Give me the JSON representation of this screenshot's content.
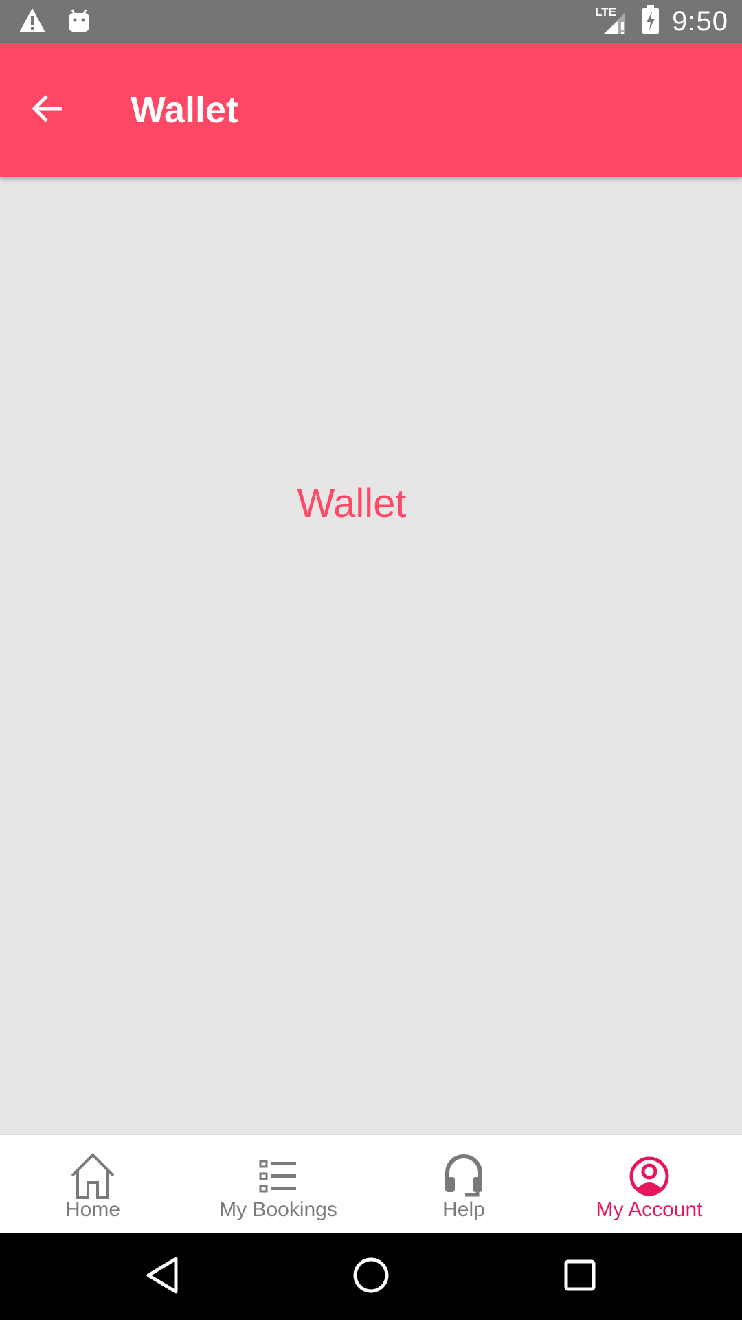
{
  "status_bar": {
    "time": "9:50",
    "network_label": "LTE",
    "icons": [
      "warning-icon",
      "android-icon",
      "lte-signal-icon",
      "battery-charging-icon"
    ]
  },
  "app_bar": {
    "title": "Wallet",
    "back_icon": "arrow-left-icon",
    "background_color": "#ff4865"
  },
  "content": {
    "label": "Wallet",
    "label_color": "#ff4865"
  },
  "bottom_nav": {
    "active_color": "#e8155e",
    "inactive_color": "#7a7a7a",
    "items": [
      {
        "label": "Home",
        "icon": "home-icon",
        "active": false
      },
      {
        "label": "My Bookings",
        "icon": "list-icon",
        "active": false
      },
      {
        "label": "Help",
        "icon": "headset-icon",
        "active": false
      },
      {
        "label": "My Account",
        "icon": "account-circle-icon",
        "active": true
      }
    ]
  },
  "system_nav": {
    "buttons": [
      "back-triangle-icon",
      "home-circle-icon",
      "recents-square-icon"
    ]
  }
}
